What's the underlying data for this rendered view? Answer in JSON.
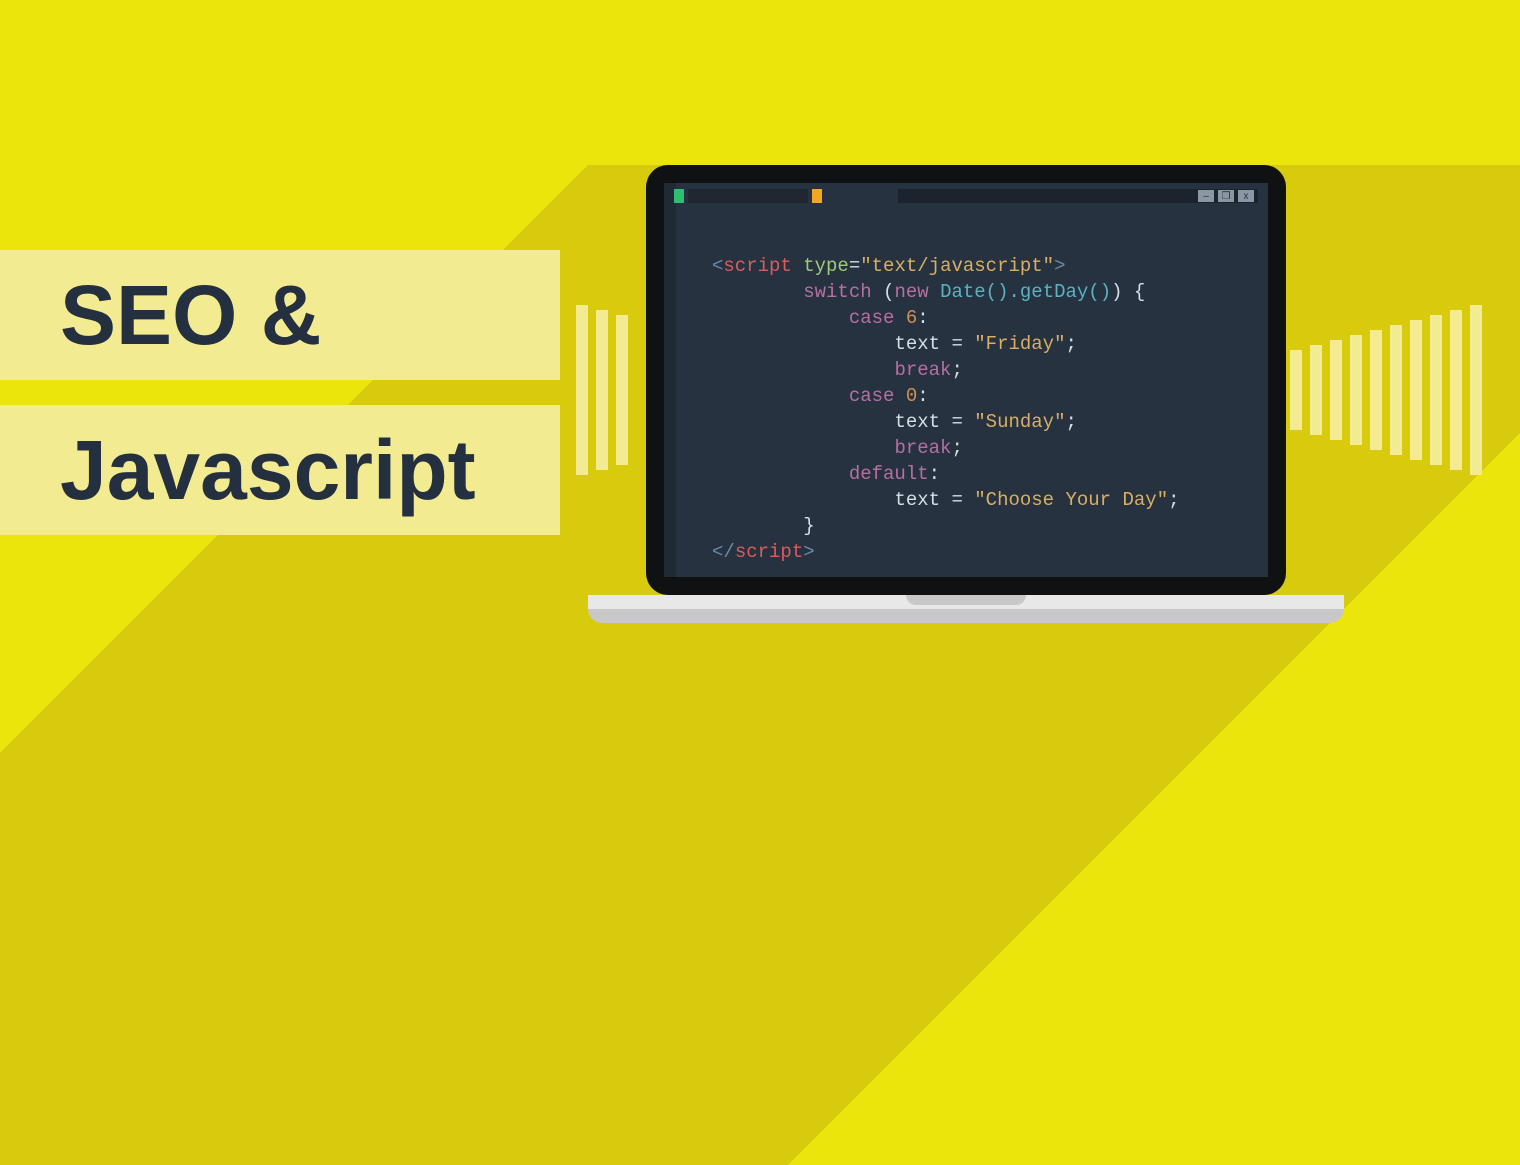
{
  "title": {
    "line1": "SEO &",
    "line2": "Javascript"
  },
  "window_controls": {
    "minimize": "–",
    "maximize": "❐",
    "close": "x"
  },
  "code": {
    "l1": {
      "open": "<",
      "tag": "script",
      "attr": " type",
      "eq": "=",
      "val": "\"text/javascript\"",
      "close": ">"
    },
    "l2": {
      "kw": "switch",
      "paren_o": " (",
      "new": "new ",
      "date": "Date()",
      "get": ".getDay()",
      "paren_c": ") {",
      "indent": "        "
    },
    "l3": {
      "indent": "            ",
      "kw": "case ",
      "num": "6",
      "colon": ":"
    },
    "l4": {
      "indent": "                ",
      "var": "text",
      "eq": " = ",
      "str": "\"Friday\"",
      "semi": ";"
    },
    "l5": {
      "indent": "                ",
      "kw": "break",
      "semi": ";"
    },
    "l6": {
      "indent": "            ",
      "kw": "case ",
      "num": "0",
      "colon": ":"
    },
    "l7": {
      "indent": "                ",
      "var": "text",
      "eq": " = ",
      "str": "\"Sunday\"",
      "semi": ";"
    },
    "l8": {
      "indent": "                ",
      "kw": "break",
      "semi": ";"
    },
    "l9": {
      "indent": "            ",
      "kw": "default",
      "colon": ":"
    },
    "l10": {
      "indent": "                ",
      "var": "text",
      "eq": " = ",
      "str": "\"Choose Your Day\"",
      "semi": ";"
    },
    "l11": {
      "indent": "        ",
      "brace": "}"
    },
    "l12": {
      "open": "</",
      "tag": "script",
      "close": ">"
    }
  }
}
